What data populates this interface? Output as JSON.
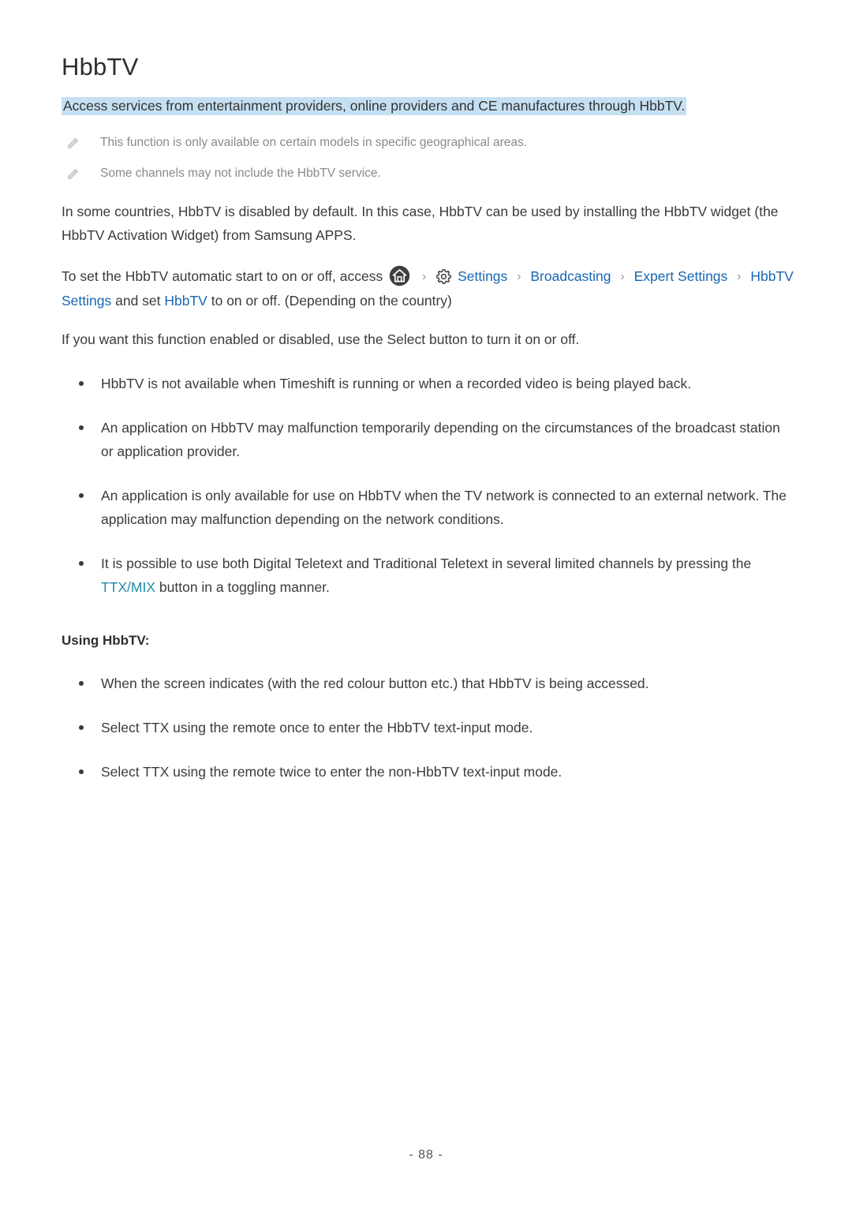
{
  "page": {
    "title": "HbbTV",
    "page_number": "- 88 -"
  },
  "banner": {
    "text": "Access services from entertainment providers, online providers and CE manufactures through HbbTV.",
    "background_color": "#c6e0f3"
  },
  "notes": [
    {
      "icon": "pencil-icon",
      "text": "This function is only available on certain models in specific geographical areas."
    },
    {
      "icon": "pencil-icon",
      "text": "Some channels may not include the HbbTV service."
    }
  ],
  "paragraphs": {
    "intro": "In some countries, HbbTV is disabled by default. In this case, HbbTV can be used by installing the HbbTV widget (the HbbTV Activation Widget) from Samsung APPS.",
    "breadcrumb_lead": "To set the HbbTV automatic start to on or off, access",
    "breadcrumb_tail_1": "and set",
    "breadcrumb_tail_2": "to on or off. (Depending on the country)",
    "select_button": "If you want this function enabled or disabled, use the Select button to turn it on or off."
  },
  "breadcrumb": {
    "home_icon": "home-icon",
    "gear_icon": "gear-icon",
    "separator": "›",
    "items": [
      {
        "label": "Settings",
        "color": "#1767b2"
      },
      {
        "label": "Broadcasting",
        "color": "#1767b2"
      },
      {
        "label": "Expert Settings",
        "color": "#1767b2"
      },
      {
        "label": "HbbTV",
        "color": "#1767b2"
      }
    ],
    "wrap_settings": "Settings",
    "wrap_hbbtv": "HbbTV"
  },
  "bullets_main": [
    {
      "text": "HbbTV is not available when Timeshift is running or when a recorded video is being played back."
    },
    {
      "text": "An application on HbbTV may malfunction temporarily depending on the circumstances of the broadcast station or application provider."
    },
    {
      "text": "An application is only available for use on HbbTV when the TV network is connected to an external network. The application may malfunction depending on the network conditions."
    }
  ],
  "bullet_teletext": {
    "prefix": "It is possible to use both Digital Teletext and Traditional Teletext in several limited channels by pressing the",
    "key_label": "TTX/MIX",
    "key_color": "#2089a8",
    "suffix": "button in a toggling manner."
  },
  "subheading": "Using HbbTV:",
  "bullets_using": [
    {
      "text": "When the screen indicates (with the red colour button etc.) that HbbTV is being accessed."
    },
    {
      "text": "Select TTX using the remote once to enter the HbbTV text-input mode."
    },
    {
      "text": "Select TTX using the remote twice to enter the non-HbbTV text-input mode."
    }
  ],
  "colors": {
    "link_blue": "#1767b2",
    "teal": "#2089a8",
    "highlight": "#c6e0f3",
    "body_text": "#3b3b3b",
    "note_text": "#8a8a8a"
  }
}
